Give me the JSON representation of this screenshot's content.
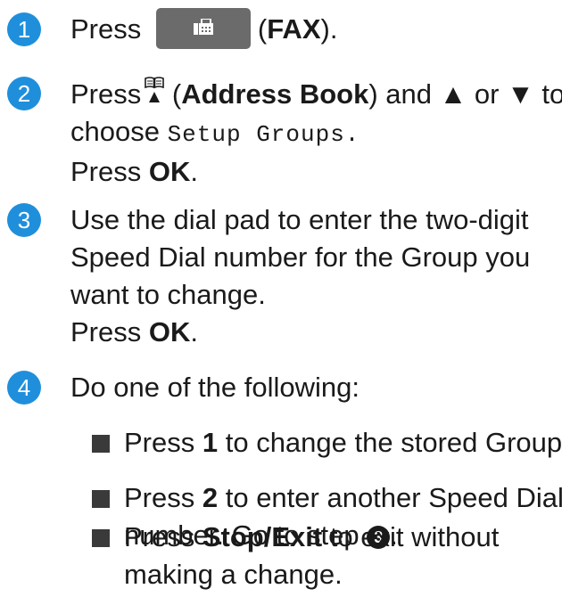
{
  "steps": [
    {
      "number": "1",
      "lines": [
        {
          "a": "Press",
          "b": "(",
          "c": "FAX",
          "d": ")."
        }
      ]
    },
    {
      "number": "2",
      "line1": {
        "a": "Press",
        "b": " (",
        "c": "Address Book",
        "d": ") and ▲ or ▼ to"
      },
      "line2": {
        "a": "choose ",
        "b": "Setup Groups."
      },
      "line3": {
        "a": "Press ",
        "b": "OK",
        "c": "."
      }
    },
    {
      "number": "3",
      "line1": "Use the dial pad to enter the two-digit",
      "line2": "Speed Dial number for the Group you",
      "line3": "want to change.",
      "line4": {
        "a": "Press ",
        "b": "OK",
        "c": "."
      }
    },
    {
      "number": "4",
      "line1": "Do one of the following:",
      "bullets": [
        {
          "a": "Press ",
          "b": "1",
          "c": " to change the stored Group."
        },
        {
          "a": "Press ",
          "b": "2",
          "c": " to enter another Speed Dial",
          "d": "number. Go to step ",
          "ref": "3",
          "e": "."
        },
        {
          "a": "Press ",
          "b": "Stop/Exit",
          "c": " to exit without",
          "d": "making a change."
        }
      ]
    }
  ],
  "icons": {
    "fax_button": "fax-icon",
    "address_book": "address-book-icon"
  },
  "colors": {
    "step_badge": "#1f8fdc",
    "fax_button_bg": "#6b6b6b"
  }
}
